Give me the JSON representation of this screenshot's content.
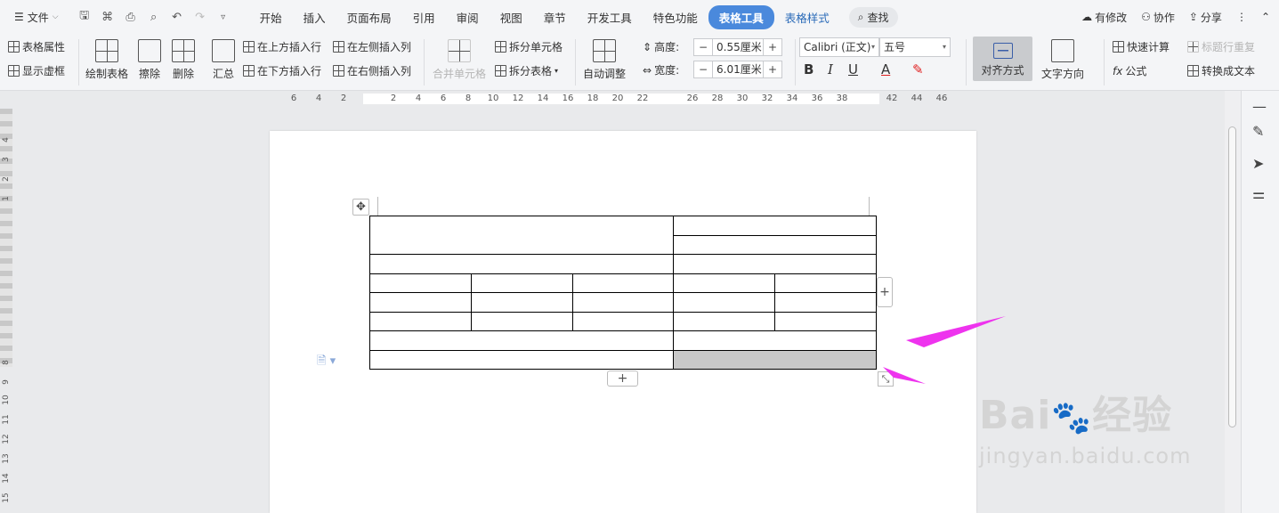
{
  "menubar": {
    "file_label": "文件",
    "tabs": [
      "开始",
      "插入",
      "页面布局",
      "引用",
      "审阅",
      "视图",
      "章节",
      "开发工具",
      "特色功能",
      "表格工具",
      "表格样式"
    ],
    "search_label": "查找",
    "right": {
      "modified": "有修改",
      "collab": "协作",
      "share": "分享"
    }
  },
  "ribbon": {
    "table_props": "表格属性",
    "show_grid": "显示虚框",
    "draw_table": "绘制表格",
    "erase": "擦除",
    "delete": "删除",
    "summary": "汇总",
    "insert_above": "在上方插入行",
    "insert_below": "在下方插入行",
    "insert_left": "在左侧插入列",
    "insert_right": "在右侧插入列",
    "merge_cells": "合并单元格",
    "split_cells": "拆分单元格",
    "split_table": "拆分表格",
    "auto_fit": "自动调整",
    "height_label": "高度:",
    "height_value": "0.55厘米",
    "width_label": "宽度:",
    "width_value": "6.01厘米",
    "font_name": "Calibri (正文)",
    "font_size": "五号",
    "align": "对齐方式",
    "text_direction": "文字方向",
    "quick_calc": "快速计算",
    "repeat_header": "标题行重复",
    "formula": "公式",
    "to_text": "转换成文本"
  },
  "ruler": {
    "h_ticks": [
      "6",
      "4",
      "2",
      "2",
      "4",
      "6",
      "8",
      "10",
      "12",
      "14",
      "16",
      "18",
      "20",
      "22",
      "26",
      "28",
      "30",
      "32",
      "34",
      "36",
      "38",
      "42",
      "44",
      "46"
    ],
    "v_ticks": [
      "4",
      "3",
      "2",
      "1",
      "8",
      "9",
      "10",
      "11",
      "12",
      "13",
      "14",
      "15"
    ]
  },
  "watermark": {
    "brand": "Bai 经验",
    "url": "jingyan.baidu.com"
  },
  "colors": {
    "accent": "#4a89dc",
    "arrow": "#ee33ee",
    "selected_cell": "#c8c8c8"
  }
}
